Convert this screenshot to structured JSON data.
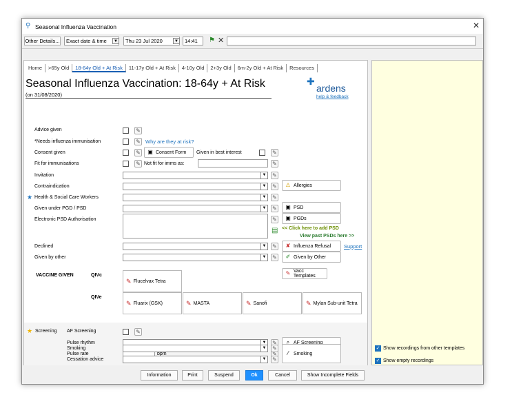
{
  "window": {
    "title": "Seasonal Influenza Vaccination",
    "close": "✕"
  },
  "toolbar": {
    "other_details": "Other Details...",
    "date_mode": "Exact date & time",
    "date": "Thu 23 Jul 2020",
    "time": "14:41",
    "flag_icon": "green-flag",
    "clear_icon": "x-mark"
  },
  "tabs": [
    "Home",
    ">65y Old",
    "18-64y Old + At Risk",
    "11-17y Old + At Risk",
    "4-10y Old",
    "2+3y Old",
    "6m-2y Old + At Risk",
    "Resources"
  ],
  "page": {
    "heading": "Seasonal Influenza Vaccination: 18-64y + At Risk",
    "date_note": "(on 31/08/2020)",
    "logo": "ardens",
    "help_link": "help & feedback"
  },
  "rows": {
    "advice": "Advice given",
    "needs": "*Needs influenza immunisation",
    "why_link": "Why are they at risk?",
    "consent": "Consent given",
    "consent_form": "Consent Form",
    "best_interest": "Given in best interest",
    "fit": "Fit for immunisations",
    "not_fit": "Not fit for imms as:",
    "invitation": "Invitation",
    "contra": "Contraindication",
    "allergies": "Allergies",
    "hscw": "Health & Social Care Workers",
    "pgd": "Given under PGD / PSD",
    "psd": "PSD",
    "pgds": "PGDs",
    "epsd": "Electronic PSD Authorisation",
    "add_psd": "<< Click here to add PSD",
    "view_psd": "View past PSDs here >>",
    "declined": "Declined",
    "refusal": "Influenza Refusal",
    "support": "Support",
    "other": "Given by other",
    "given_other": "Given by Other",
    "vacc_templates": "Vacc Templates"
  },
  "vaccine": {
    "heading": "VACCINE GIVEN",
    "qivc": "QIVc",
    "qive": "QIVe",
    "flucelvax": "Flucelvax Tetra",
    "fluarix": "Fluarix (GSK)",
    "masta": "MASTA",
    "sanofi": "Sanofi",
    "mylan": "Mylan Sub-unit Tetra"
  },
  "screening": {
    "label": "Screening",
    "af": "AF Screening",
    "rhythm": "Pulse rhythm",
    "rate": "Pulse rate",
    "bpm": "bpm",
    "smoking": "Smoking",
    "cessation": "Cessation advice",
    "af_btn": "AF Screening",
    "smoking_btn": "Smoking"
  },
  "side": {
    "show_other": "Show recordings from other templates",
    "show_empty": "Show empty recordings"
  },
  "bottom": {
    "information": "Information",
    "print": "Print",
    "suspend": "Suspend",
    "ok": "Ok",
    "cancel": "Cancel",
    "incomplete": "Show Incomplete Fields"
  }
}
